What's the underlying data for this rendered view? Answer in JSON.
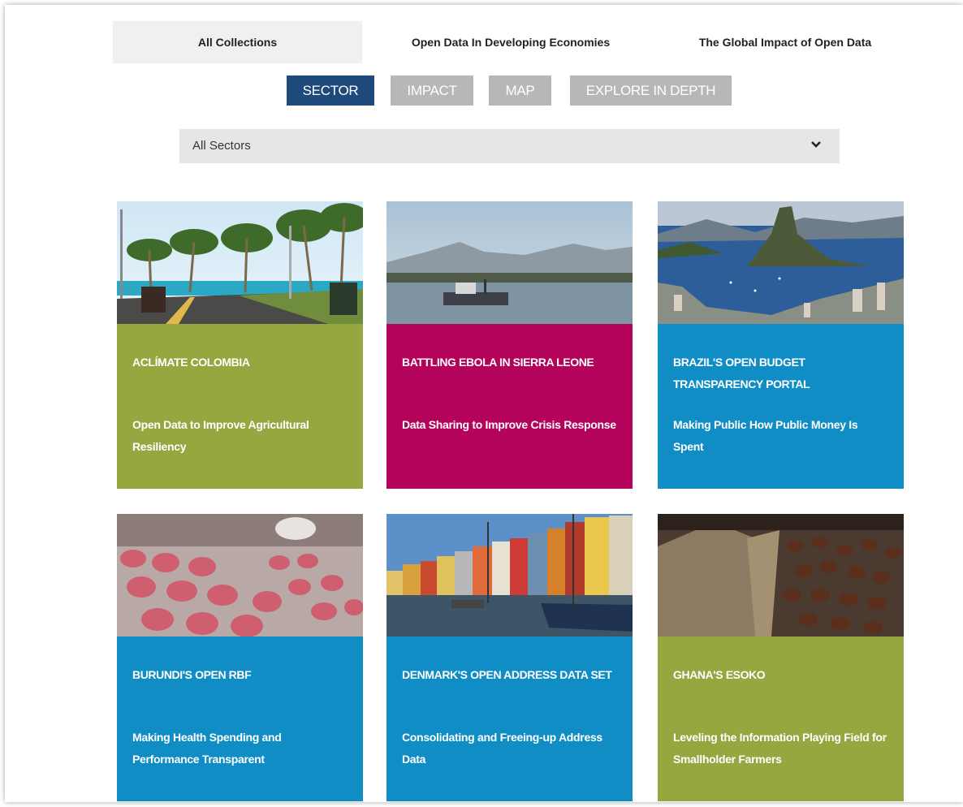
{
  "collections": {
    "tabs": [
      {
        "label": "All Collections",
        "active": true
      },
      {
        "label": "Open Data In Developing Economies",
        "active": false
      },
      {
        "label": "The Global Impact of Open Data",
        "active": false
      }
    ]
  },
  "views": {
    "buttons": [
      {
        "label": "SECTOR",
        "active": true
      },
      {
        "label": "IMPACT",
        "active": false
      },
      {
        "label": "MAP",
        "active": false
      },
      {
        "label": "EXPLORE IN DEPTH",
        "active": false
      }
    ]
  },
  "filter": {
    "selected": "All Sectors",
    "icon": "chevron-down-icon"
  },
  "colors": {
    "active_view": "#1d4a7a",
    "inactive_view": "#b7b7b7",
    "green": "#98a63f",
    "magenta": "#b3035b",
    "blue": "#118dc6"
  },
  "cards": [
    {
      "title": "ACLÍMATE COLOMBIA",
      "subtitle": "Open Data to Improve Agricultural Resiliency",
      "color": "green",
      "image": "palm-road-image"
    },
    {
      "title": "BATTLING EBOLA IN SIERRA LEONE",
      "subtitle": "Data Sharing to Improve Crisis Response",
      "color": "magenta",
      "image": "harbor-boat-image"
    },
    {
      "title": "BRAZIL'S OPEN BUDGET TRANSPARENCY PORTAL",
      "subtitle": "Making Public How Public Money Is Spent",
      "color": "blue",
      "image": "rio-bay-image"
    },
    {
      "title": "BURUNDI'S OPEN RBF",
      "subtitle": "Making Health Spending and Performance Transparent",
      "color": "blue",
      "image": "pills-image"
    },
    {
      "title": "DENMARK'S OPEN ADDRESS DATA SET",
      "subtitle": "Consolidating and Freeing-up Address Data",
      "color": "blue",
      "image": "canal-houses-image"
    },
    {
      "title": "GHANA'S ESOKO",
      "subtitle": "Leveling the Information Playing Field for Smallholder Farmers",
      "color": "green",
      "image": "coffee-beans-image"
    }
  ]
}
